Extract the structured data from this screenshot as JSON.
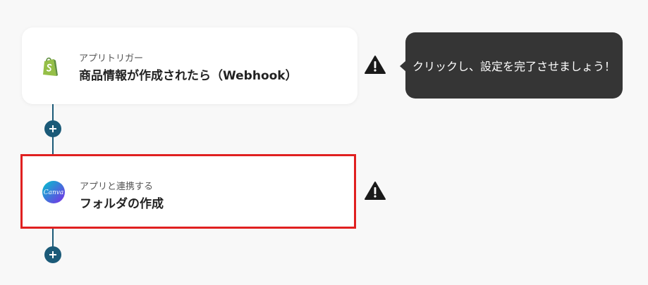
{
  "flow": {
    "steps": [
      {
        "subtitle": "アプリトリガー",
        "title": "商品情報が作成されたら（Webhook）",
        "app_icon": "shopify-icon",
        "status_icon": "warning-icon"
      },
      {
        "subtitle": "アプリと連携する",
        "title": "フォルダの作成",
        "app_icon": "canva-icon",
        "status_icon": "warning-icon"
      }
    ],
    "add_button_label": "+"
  },
  "tooltip": {
    "text": "クリックし、設定を完了させましょう！"
  },
  "canva_logo_text": "Canva",
  "colors": {
    "background": "#f8f8f8",
    "connector": "#1b5a78",
    "highlight_border": "#e02020",
    "tooltip_bg": "#353535",
    "shopify_green": "#95bf47",
    "canva_gradient_start": "#00c4cc",
    "canva_gradient_end": "#7d2ae8"
  }
}
